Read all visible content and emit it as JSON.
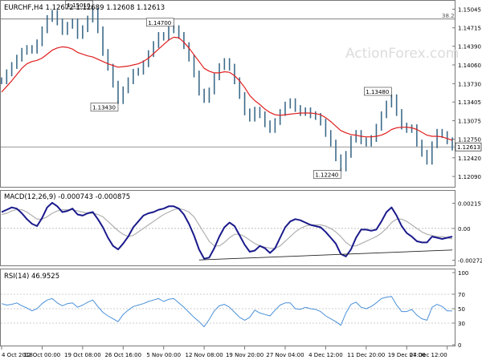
{
  "watermark": "ActionForex.com",
  "colors": {
    "price": "#3d6b8a",
    "ma": "#e01e1e",
    "macd": "#1a1a8c",
    "signal": "#b0b0b0",
    "rsi": "#4a90d9",
    "frame": "#777777",
    "grid": "#cfcfcf"
  },
  "chart_data": [
    {
      "type": "line",
      "title": "EURCHF,H4  1.12672  1.12689  1.12608  1.12613",
      "legend_position": "top-left",
      "ylim": [
        1.1195,
        1.1515
      ],
      "yticks": [
        "1.15045",
        "1.14715",
        "1.14390",
        "1.14060",
        "1.13730",
        "1.13405",
        "1.13075",
        "1.12750",
        "1.12420",
        "1.12090"
      ],
      "ytick_values": [
        1.15045,
        1.14715,
        1.1439,
        1.1406,
        1.1373,
        1.13405,
        1.13075,
        1.1275,
        1.1242,
        1.1209
      ],
      "fib_label": "38.2",
      "fib_level": 1.1487,
      "last_price_label": "1.12613",
      "last_price": 1.12613,
      "series": [
        {
          "values": [
            1.1378,
            1.1392,
            1.1405,
            1.1418,
            1.143,
            1.1435,
            1.1432,
            1.1445,
            1.1468,
            1.1488,
            1.1497,
            1.1482,
            1.1465,
            1.1476,
            1.1482,
            1.1458,
            1.147,
            1.1487,
            1.1501,
            1.1468,
            1.1428,
            1.1402,
            1.1372,
            1.1343,
            1.1362,
            1.1378,
            1.1393,
            1.1395,
            1.1408,
            1.1426,
            1.1442,
            1.1458,
            1.1455,
            1.1468,
            1.147,
            1.1458,
            1.144,
            1.1418,
            1.139,
            1.1358,
            1.1345,
            1.136,
            1.1385,
            1.1403,
            1.1412,
            1.1402,
            1.1378,
            1.1352,
            1.1323,
            1.1312,
            1.1326,
            1.1318,
            1.1302,
            1.1292,
            1.1306,
            1.1322,
            1.1335,
            1.1341,
            1.1329,
            1.1322,
            1.1325,
            1.1318,
            1.1315,
            1.1305,
            1.1285,
            1.1268,
            1.1242,
            1.1224,
            1.1248,
            1.1275,
            1.1285,
            1.1272,
            1.1268,
            1.1276,
            1.1296,
            1.1318,
            1.1337,
            1.1348,
            1.1322,
            1.1298,
            1.1292,
            1.1295,
            1.1268,
            1.125,
            1.1236,
            1.1265,
            1.1287,
            1.1283,
            1.1272,
            1.1261
          ]
        },
        {
          "values": [
            1.1358,
            1.1368,
            1.1378,
            1.1389,
            1.14,
            1.1408,
            1.1412,
            1.1414,
            1.1418,
            1.1425,
            1.1432,
            1.1436,
            1.1438,
            1.1437,
            1.1434,
            1.1428,
            1.1425,
            1.1422,
            1.142,
            1.1416,
            1.1412,
            1.1408,
            1.1405,
            1.1402,
            1.1403,
            1.1404,
            1.1406,
            1.1408,
            1.1412,
            1.1418,
            1.1426,
            1.1434,
            1.1442,
            1.145,
            1.1455,
            1.1454,
            1.1446,
            1.1436,
            1.1424,
            1.1412,
            1.14,
            1.1395,
            1.1392,
            1.1392,
            1.1394,
            1.1393,
            1.1387,
            1.1378,
            1.1366,
            1.1352,
            1.1343,
            1.1336,
            1.1328,
            1.1322,
            1.1318,
            1.1317,
            1.1318,
            1.1319,
            1.132,
            1.1321,
            1.1321,
            1.1321,
            1.132,
            1.1318,
            1.1313,
            1.1306,
            1.1298,
            1.129,
            1.1286,
            1.1283,
            1.1282,
            1.128,
            1.1279,
            1.1279,
            1.128,
            1.1282,
            1.1286,
            1.1292,
            1.1295,
            1.1296,
            1.1296,
            1.1295,
            1.1292,
            1.1287,
            1.1282,
            1.128,
            1.128,
            1.1279,
            1.1276,
            1.1273
          ]
        }
      ],
      "annotations": [
        {
          "text": "1.15010",
          "index": 18,
          "value": 1.1501
        },
        {
          "text": "1.14700",
          "index": 34,
          "value": 1.147
        },
        {
          "text": "1.13430",
          "index": 23,
          "value": 1.1343
        },
        {
          "text": "1.13480",
          "index": 77,
          "value": 1.1348
        },
        {
          "text": "1.12240",
          "index": 67,
          "value": 1.1224
        }
      ]
    },
    {
      "type": "line",
      "title": "MACD(12,26,9) -0.000743 -0.000875",
      "legend_position": "top-left",
      "ylim": [
        -0.0031,
        0.0024
      ],
      "yticks": [
        "0.002157",
        "0.00",
        "-0.002729"
      ],
      "ytick_values": [
        0.002157,
        0,
        -0.002729
      ],
      "series": [
        {
          "values": [
            0.0014,
            0.0016,
            0.0018,
            0.0017,
            0.0013,
            0.0008,
            0.0004,
            0.0002,
            0.0009,
            0.0018,
            0.0022,
            0.0019,
            0.0014,
            0.0015,
            0.0017,
            0.0012,
            0.0011,
            0.0013,
            0.0014,
            0.0008,
            0.0001,
            -0.0008,
            -0.0015,
            -0.0018,
            -0.0013,
            -0.0007,
            0.0001,
            0.0006,
            0.0011,
            0.0013,
            0.0014,
            0.0016,
            0.0017,
            0.0019,
            0.0019,
            0.0017,
            0.0012,
            0.0004,
            -0.0006,
            -0.0018,
            -0.0026,
            -0.0025,
            -0.0017,
            -0.0007,
            0.0001,
            0.0005,
            0.0002,
            -0.0006,
            -0.0014,
            -0.002,
            -0.0019,
            -0.0015,
            -0.0017,
            -0.0021,
            -0.0017,
            -0.0008,
            0.0001,
            0.0006,
            0.0008,
            0.0007,
            0.0005,
            0.0003,
            0.0002,
            0.0001,
            -0.0003,
            -0.0008,
            -0.0013,
            -0.0022,
            -0.0024,
            -0.0018,
            -0.0008,
            -0.0001,
            -0.0001,
            -0.0002,
            -0.0001,
            0.0006,
            0.0014,
            0.0018,
            0.0011,
            0.0002,
            -0.0004,
            -0.0007,
            -0.0011,
            -0.0012,
            -0.0012,
            -0.0007,
            -0.0008,
            -0.0009,
            -0.0008,
            -0.0007
          ]
        },
        {
          "values": [
            0.0012,
            0.0013,
            0.0015,
            0.0016,
            0.0016,
            0.0014,
            0.0011,
            0.0008,
            0.0008,
            0.001,
            0.0013,
            0.0015,
            0.0016,
            0.0016,
            0.0016,
            0.0015,
            0.0014,
            0.0013,
            0.0013,
            0.0012,
            0.001,
            0.0006,
            0.0002,
            -0.0002,
            -0.0005,
            -0.0007,
            -0.0006,
            -0.0003,
            0.0,
            0.0003,
            0.0006,
            0.0009,
            0.0012,
            0.0014,
            0.0016,
            0.0017,
            0.0016,
            0.0014,
            0.001,
            0.0003,
            -0.0004,
            -0.0011,
            -0.0015,
            -0.0015,
            -0.0012,
            -0.0008,
            -0.0005,
            -0.0005,
            -0.0007,
            -0.001,
            -0.0013,
            -0.0015,
            -0.0016,
            -0.0017,
            -0.0017,
            -0.0015,
            -0.0011,
            -0.0007,
            -0.0003,
            0.0,
            0.0002,
            0.0003,
            0.0003,
            0.0003,
            0.0002,
            0.0,
            -0.0003,
            -0.0007,
            -0.0012,
            -0.0015,
            -0.0015,
            -0.0013,
            -0.0011,
            -0.0009,
            -0.0007,
            -0.0004,
            0.0,
            0.0005,
            0.0008,
            0.0008,
            0.0006,
            0.0003,
            0.0,
            -0.0003,
            -0.0005,
            -0.0006,
            -0.0007,
            -0.0007,
            -0.0008,
            -0.0009
          ]
        }
      ],
      "trendline": [
        {
          "index": 39,
          "value": -0.0027
        },
        {
          "index": 89,
          "value": -0.00185
        }
      ]
    },
    {
      "type": "line",
      "title": "RSI(14) 46.9525",
      "legend_position": "top-left",
      "ylim": [
        0,
        100
      ],
      "yticks": [
        "100",
        "70",
        "50",
        "30",
        "0"
      ],
      "ytick_values": [
        100,
        70,
        50,
        30,
        0
      ],
      "series": [
        {
          "values": [
            57,
            55,
            56,
            58,
            54,
            51,
            47,
            50,
            57,
            62,
            64,
            58,
            54,
            57,
            58,
            52,
            55,
            59,
            62,
            53,
            45,
            40,
            36,
            32,
            42,
            48,
            53,
            55,
            57,
            60,
            62,
            64,
            60,
            63,
            64,
            58,
            52,
            45,
            38,
            32,
            25,
            35,
            47,
            54,
            56,
            52,
            45,
            38,
            34,
            38,
            48,
            44,
            42,
            40,
            48,
            55,
            58,
            58,
            50,
            49,
            52,
            50,
            49,
            46,
            40,
            36,
            32,
            27,
            44,
            56,
            59,
            52,
            50,
            53,
            58,
            64,
            66,
            67,
            55,
            46,
            46,
            49,
            41,
            36,
            34,
            52,
            56,
            53,
            47,
            47
          ]
        }
      ]
    }
  ],
  "x_axis": {
    "tick_labels": [
      "4 Oct 2018",
      "12 Oct 00:00",
      "19 Oct 08:00",
      "26 Oct 16:00",
      "5 Nov 00:00",
      "12 Nov 08:00",
      "19 Nov 20:00",
      "27 Nov 04:00",
      "4 Dec 12:00",
      "11 Dec 20:00",
      "19 Dec 04:00",
      "27 Dec 12:00"
    ],
    "tick_index": [
      0,
      8,
      16,
      24,
      32,
      40,
      48,
      56,
      64,
      72,
      80,
      88
    ]
  }
}
